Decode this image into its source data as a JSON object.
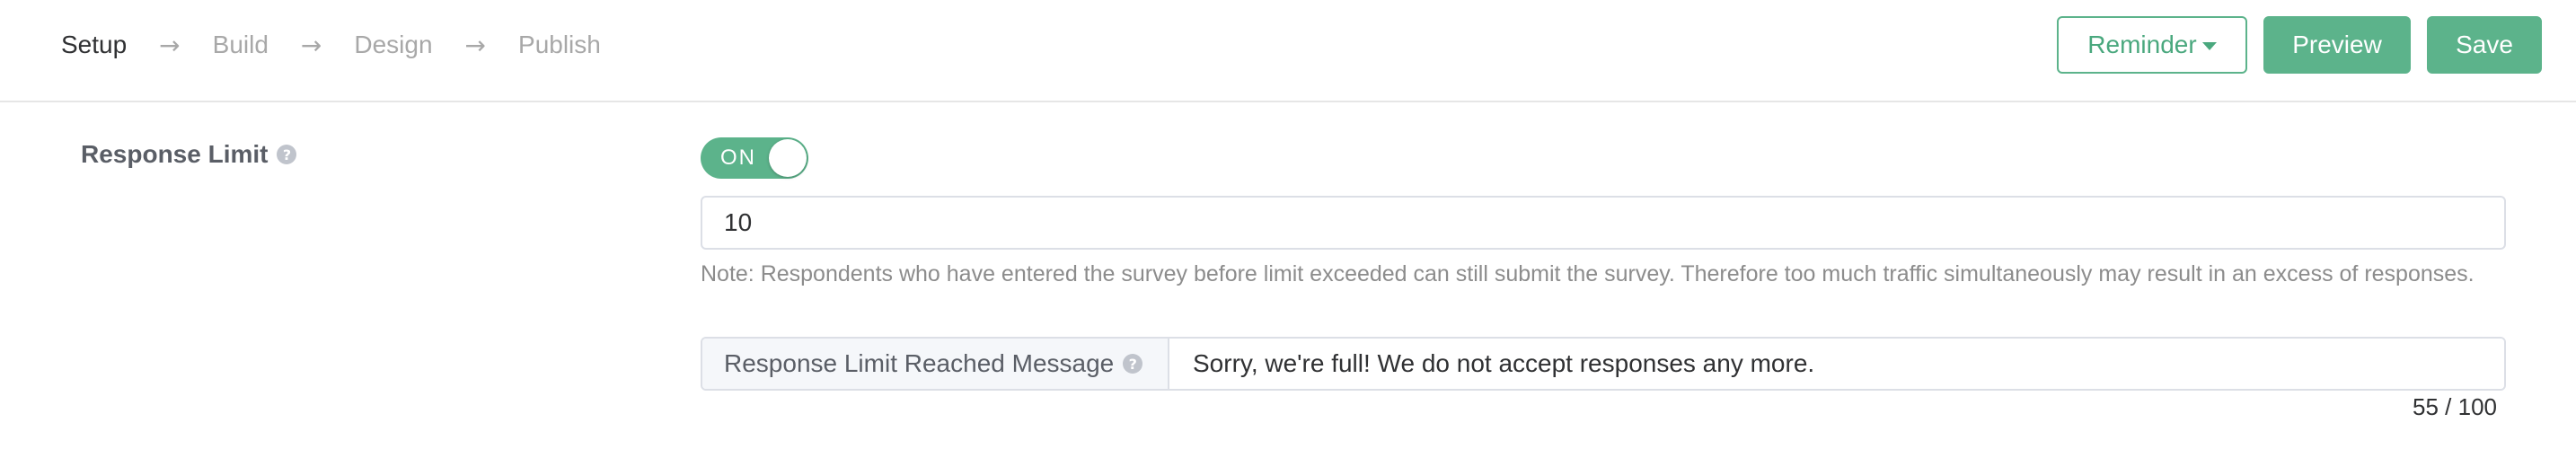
{
  "steps": [
    {
      "label": "Setup",
      "active": true
    },
    {
      "label": "Build",
      "active": false
    },
    {
      "label": "Design",
      "active": false
    },
    {
      "label": "Publish",
      "active": false
    }
  ],
  "arrow_glyph": "→",
  "actions": {
    "reminder_label": "Reminder",
    "preview_label": "Preview",
    "save_label": "Save"
  },
  "response_limit": {
    "label": "Response Limit",
    "help_glyph": "?",
    "toggle_state": "ON",
    "value": "10",
    "note": "Note: Respondents who have entered the survey before limit exceeded can still submit the survey. Therefore too much traffic simultaneously may result in an excess of responses.",
    "message_label": "Response Limit Reached Message",
    "message_value": "Sorry, we're full! We do not accept responses any more.",
    "counter": "55 / 100"
  },
  "colors": {
    "accent": "#5cb38b",
    "muted_text": "#8c8c8c",
    "border": "#dcdfe6"
  }
}
